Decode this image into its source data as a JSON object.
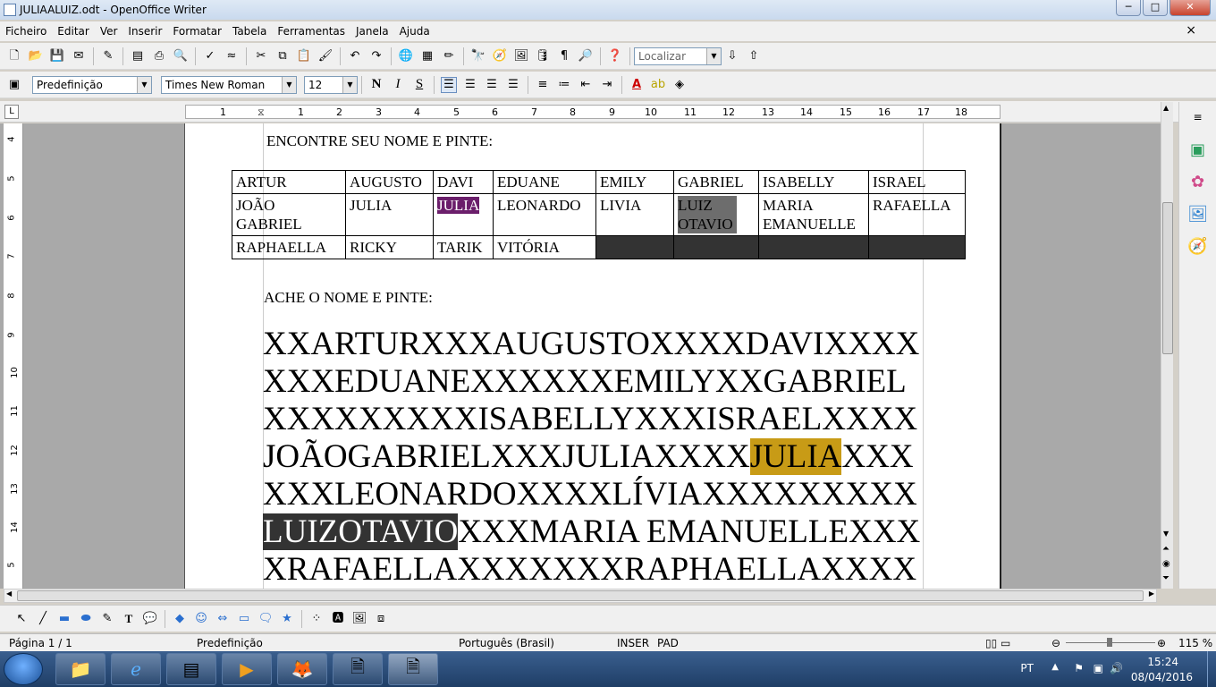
{
  "window": {
    "title": "JULIAALUIZ.odt - OpenOffice Writer",
    "min": "─",
    "max": "□",
    "close": "✕"
  },
  "menu": [
    "Ficheiro",
    "Editar",
    "Ver",
    "Inserir",
    "Formatar",
    "Tabela",
    "Ferramentas",
    "Janela",
    "Ajuda"
  ],
  "menu_close": "×",
  "toolbar": {
    "find_placeholder": "Localizar"
  },
  "format": {
    "style": "Predefinição",
    "font": "Times New Roman",
    "size": "12",
    "bold": "N",
    "italic": "I",
    "underline": "S"
  },
  "ruler_h": [
    "1",
    "1",
    "2",
    "3",
    "4",
    "5",
    "6",
    "7",
    "8",
    "9",
    "10",
    "11",
    "12",
    "13",
    "14",
    "15",
    "16",
    "17",
    "18"
  ],
  "ruler_v": [
    "4",
    "5",
    "6",
    "7",
    "8",
    "9",
    "10",
    "11",
    "12",
    "13",
    "14",
    "5"
  ],
  "document": {
    "heading1": "ENCONTRE SEU NOME E PINTE:",
    "table": [
      [
        "ARTUR",
        "AUGUSTO",
        "DAVI",
        "EDUANE",
        "EMILY",
        "GABRIEL",
        "ISABELLY",
        "ISRAEL"
      ],
      [
        "JOÃO GABRIEL",
        "JULIA",
        "JULIA",
        "LEONARDO",
        "LIVIA",
        "LUIZ OTAVIO",
        "MARIA EMANUELLE",
        "RAFAELLA"
      ],
      [
        "RAPHAELLA",
        "RICKY",
        "TARIK",
        "VITÓRIA",
        "",
        "",
        "",
        ""
      ]
    ],
    "heading2": "ACHE O NOME E PINTE:",
    "lines": {
      "l1": "XXARTURXXXAUGUSTOXXXXDAVIXXXX",
      "l2": "XXXEDUANEXXXXXXEMILYXXGABRIEL",
      "l3": "XXXXXXXXXISABELLYXXXISRAELXXXX",
      "l4a": "JOÃOGABRIELXXXJULIAXXXX",
      "l4b": "JULIA",
      "l4c": "XXX",
      "l5": "XXXLEONARDOXXXXLÍVIAXXXXXXXXX",
      "l6a": "LUIZOTAVIO",
      "l6b": "XXXMARIA EMANUELLEXXX",
      "l7": "XRAFAELLAXXXXXXXRAPHAELLAXXXX"
    }
  },
  "status": {
    "page": "Página 1 / 1",
    "style": "Predefinição",
    "lang": "Português (Brasil)",
    "ins": "INSER",
    "pad": "PAD",
    "zoom": "115 %"
  },
  "tray": {
    "lang": "PT",
    "time": "15:24",
    "date": "08/04/2016"
  }
}
